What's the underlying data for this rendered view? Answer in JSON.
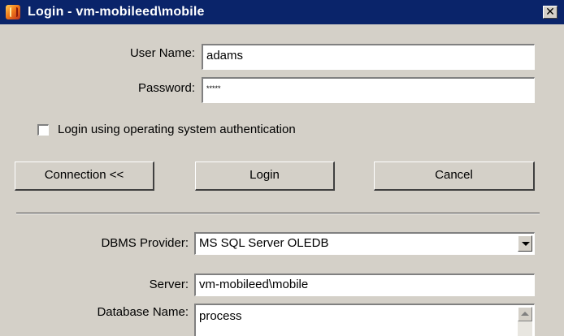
{
  "window": {
    "title": "Login - vm-mobileed\\mobile",
    "close_label": "✕"
  },
  "credentials": {
    "username_label": "User Name:",
    "username_value": "adams",
    "password_label": "Password:",
    "password_value": "*****"
  },
  "os_auth": {
    "label": "Login using operating system authentication",
    "checked": false
  },
  "buttons": {
    "connection_label": "Connection <<",
    "login_label": "Login",
    "cancel_label": "Cancel"
  },
  "connection": {
    "dbms_label": "DBMS Provider:",
    "dbms_value": "MS SQL Server OLEDB",
    "server_label": "Server:",
    "server_value": "vm-mobileed\\mobile",
    "database_label": "Database Name:",
    "database_value": "process"
  },
  "colors": {
    "titlebar": "#0a246a",
    "dialog_face": "#d4d0c8"
  },
  "icons": {
    "app": "app-logo-icon",
    "close": "close-icon",
    "dropdown": "chevron-down-icon",
    "scroll_up": "scroll-up-arrow-icon"
  }
}
